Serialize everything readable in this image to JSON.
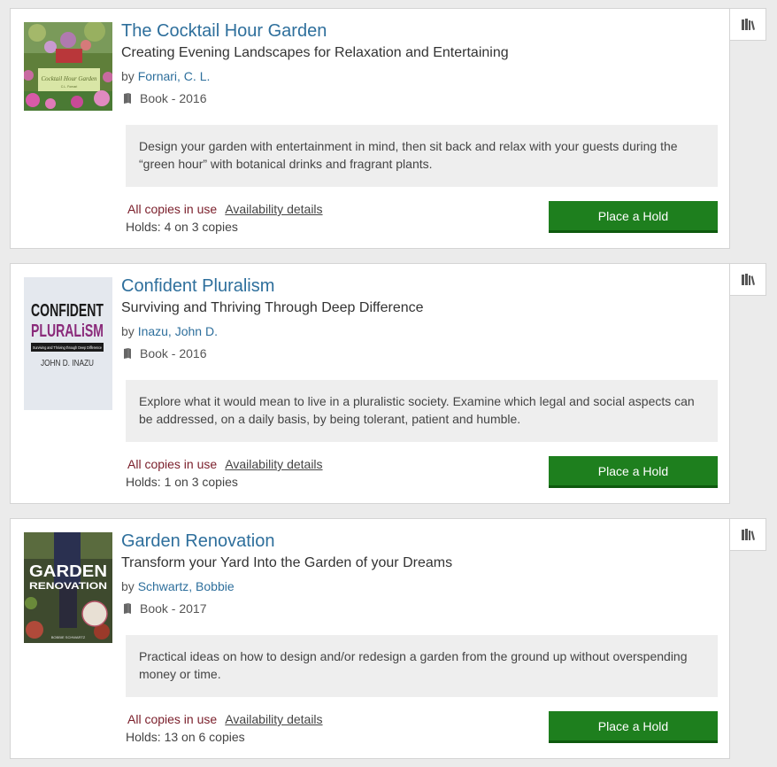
{
  "results": [
    {
      "title": "The Cocktail Hour Garden",
      "subtitle": "Creating Evening Landscapes for Relaxation and Entertaining",
      "by_prefix": "by",
      "author": "Fornari, C. L.",
      "format": "Book - 2016",
      "summary": "Design your garden with entertainment in mind, then sit back and relax with your guests during the “green hour” with botanical drinks and fragrant plants.",
      "status": "All copies in use",
      "availability_link": "Availability details",
      "holds": "Holds: 4 on 3 copies",
      "hold_button": "Place a Hold",
      "cover_text": "Cocktail Hour Garden",
      "cover_author": "C.L. Fornari"
    },
    {
      "title": "Confident Pluralism",
      "subtitle": "Surviving and Thriving Through Deep Difference",
      "by_prefix": "by",
      "author": "Inazu, John D.",
      "format": "Book - 2016",
      "summary": "Explore what it would mean to live in a pluralistic society. Examine which legal and social aspects can be addressed, on a daily basis, by being tolerant, patient and humble.",
      "status": "All copies in use",
      "availability_link": "Availability details",
      "holds": "Holds: 1 on 3 copies",
      "hold_button": "Place a Hold",
      "cover_line1": "CONFIDENT",
      "cover_line2": "PLURALiSM",
      "cover_tagline": "Surviving and Thriving through Deep Difference",
      "cover_author": "JOHN D. INAZU"
    },
    {
      "title": "Garden Renovation",
      "subtitle": "Transform your Yard Into the Garden of your Dreams",
      "by_prefix": "by",
      "author": "Schwartz, Bobbie",
      "format": "Book - 2017",
      "summary": "Practical ideas on how to design and/or redesign a garden from the ground up without overspending money or time.",
      "status": "All copies in use",
      "availability_link": "Availability details",
      "holds": "Holds: 13 on 6 copies",
      "hold_button": "Place a Hold",
      "cover_line1": "GARDEN",
      "cover_line2": "RENOVATION",
      "cover_author": "BOBBIE SCHWARTZ"
    }
  ],
  "colors": {
    "link": "#2e6f9c",
    "status": "#7a1e2a",
    "button": "#1e7f1e",
    "summary_bg": "#eeeeee"
  },
  "icons": {
    "shelf": "add-to-shelf-icon",
    "format": "book-icon"
  }
}
